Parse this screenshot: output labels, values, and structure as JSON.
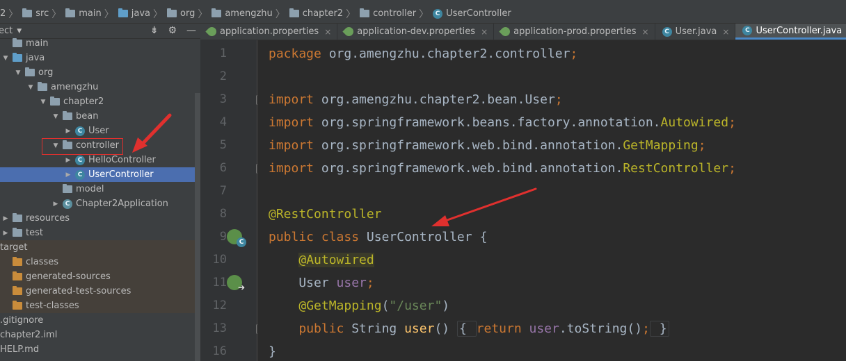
{
  "breadcrumb": [
    "2",
    "src",
    "main",
    "java",
    "org",
    "amengzhu",
    "chapter2",
    "controller",
    "UserController"
  ],
  "panel": {
    "title": "ect",
    "tools": [
      "split-icon",
      "gear-icon",
      "minimize-icon"
    ]
  },
  "tree": [
    {
      "label": "main",
      "indent": 0,
      "arrow": "",
      "icon": "folder"
    },
    {
      "label": "java",
      "indent": 0,
      "arrow": "down",
      "icon": "folder-blue"
    },
    {
      "label": "org",
      "indent": 1,
      "arrow": "down",
      "icon": "folder"
    },
    {
      "label": "amengzhu",
      "indent": 2,
      "arrow": "down",
      "icon": "folder"
    },
    {
      "label": "chapter2",
      "indent": 3,
      "arrow": "down",
      "icon": "folder"
    },
    {
      "label": "bean",
      "indent": 4,
      "arrow": "down",
      "icon": "folder"
    },
    {
      "label": "User",
      "indent": 5,
      "arrow": "right",
      "icon": "class"
    },
    {
      "label": "controller",
      "indent": 4,
      "arrow": "down",
      "icon": "folder"
    },
    {
      "label": "HelloController",
      "indent": 5,
      "arrow": "right",
      "icon": "class"
    },
    {
      "label": "UserController",
      "indent": 5,
      "arrow": "right",
      "icon": "class",
      "selected": true
    },
    {
      "label": "model",
      "indent": 4,
      "arrow": "",
      "icon": "folder"
    },
    {
      "label": "Chapter2Application",
      "indent": 4,
      "arrow": "right",
      "icon": "spring-class"
    },
    {
      "label": "resources",
      "indent": 0,
      "arrow": "right",
      "icon": "folder-res"
    },
    {
      "label": "test",
      "indent": 0,
      "arrow": "right",
      "icon": "folder"
    },
    {
      "label": "target",
      "indent": -1,
      "arrow": "",
      "icon": "",
      "lib": true
    },
    {
      "label": "classes",
      "indent": 0,
      "arrow": "",
      "icon": "folder-orange",
      "lib": true
    },
    {
      "label": "generated-sources",
      "indent": 0,
      "arrow": "",
      "icon": "folder-orange",
      "lib": true
    },
    {
      "label": "generated-test-sources",
      "indent": 0,
      "arrow": "",
      "icon": "folder-orange",
      "lib": true
    },
    {
      "label": "test-classes",
      "indent": 0,
      "arrow": "",
      "icon": "folder-orange",
      "lib": true
    },
    {
      "label": ".gitignore",
      "indent": -1,
      "arrow": "",
      "icon": ""
    },
    {
      "label": "chapter2.iml",
      "indent": -1,
      "arrow": "",
      "icon": ""
    },
    {
      "label": "HELP.md",
      "indent": -1,
      "arrow": "",
      "icon": ""
    }
  ],
  "tabs": [
    {
      "label": "application.properties",
      "icon": "leaf"
    },
    {
      "label": "application-dev.properties",
      "icon": "leaf"
    },
    {
      "label": "application-prod.properties",
      "icon": "leaf"
    },
    {
      "label": "User.java",
      "icon": "class"
    },
    {
      "label": "UserController.java",
      "icon": "class",
      "active": true
    }
  ],
  "code": {
    "line_numbers": [
      "1",
      "2",
      "3",
      "4",
      "5",
      "6",
      "7",
      "8",
      "9",
      "10",
      "11",
      "12",
      "13",
      "16"
    ],
    "lines": [
      [
        [
          "kw",
          "package "
        ],
        [
          "",
          "org.amengzhu.chapter2.controller"
        ],
        [
          "kw",
          ";"
        ]
      ],
      [],
      [
        [
          "kw",
          "import "
        ],
        [
          "",
          "org.amengzhu.chapter2.bean.User"
        ],
        [
          "kw",
          ";"
        ]
      ],
      [
        [
          "kw",
          "import "
        ],
        [
          "",
          "org.springframework.beans.factory.annotation."
        ],
        [
          "ann",
          "Autowired"
        ],
        [
          "kw",
          ";"
        ]
      ],
      [
        [
          "kw",
          "import "
        ],
        [
          "",
          "org.springframework.web.bind.annotation."
        ],
        [
          "ann",
          "GetMapping"
        ],
        [
          "kw",
          ";"
        ]
      ],
      [
        [
          "kw",
          "import "
        ],
        [
          "",
          "org.springframework.web.bind.annotation."
        ],
        [
          "ann",
          "RestController"
        ],
        [
          "kw",
          ";"
        ]
      ],
      [],
      [
        [
          "ann",
          "@RestController"
        ]
      ],
      [
        [
          "kw",
          "public class "
        ],
        [
          "",
          "UserController {"
        ]
      ],
      [
        [
          "",
          "    "
        ],
        [
          "ann hl",
          "@Autowired"
        ]
      ],
      [
        [
          "",
          "    User "
        ],
        [
          "fld",
          "user"
        ],
        [
          "kw",
          ";"
        ]
      ],
      [
        [
          "",
          "    "
        ],
        [
          "ann",
          "@GetMapping"
        ],
        [
          "",
          "("
        ],
        [
          "str",
          "\"/user\""
        ],
        [
          "",
          ")"
        ]
      ],
      [
        [
          "",
          "    "
        ],
        [
          "kw",
          "public "
        ],
        [
          "",
          "String "
        ],
        [
          "fn",
          "user"
        ],
        [
          "",
          "() "
        ],
        [
          "box",
          "{ "
        ],
        [
          "kw",
          "return "
        ],
        [
          "fld",
          "user"
        ],
        [
          "",
          ".toString()"
        ],
        [
          "kw",
          ";"
        ],
        [
          "box",
          " }"
        ]
      ],
      [
        [
          "",
          "}"
        ]
      ]
    ]
  },
  "colors": {
    "accent": "#4a88c7",
    "annotation_red": "#e0302e",
    "selection": "#4b6eaf"
  }
}
